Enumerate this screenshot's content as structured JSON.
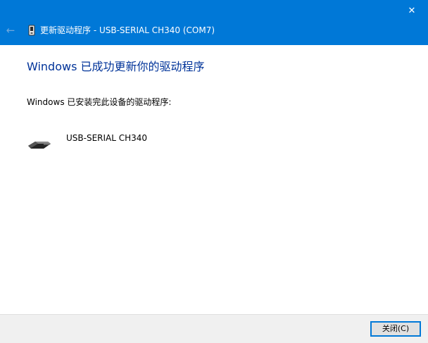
{
  "window": {
    "title": "更新驱动程序 - USB-SERIAL CH340 (COM7)",
    "close_glyph": "✕",
    "back_glyph": "←"
  },
  "content": {
    "heading": "Windows 已成功更新你的驱动程序",
    "description": "Windows 已安装完此设备的驱动程序:",
    "device_name": "USB-SERIAL CH340"
  },
  "footer": {
    "close_label": "关闭(C)"
  },
  "colors": {
    "titlebar": "#0078d7",
    "heading": "#003399",
    "footer_bg": "#f0f0f0",
    "button_border": "#0078d7"
  },
  "icons": {
    "title_icon": "usb-device-icon",
    "device_icon": "usb-cable-icon"
  }
}
